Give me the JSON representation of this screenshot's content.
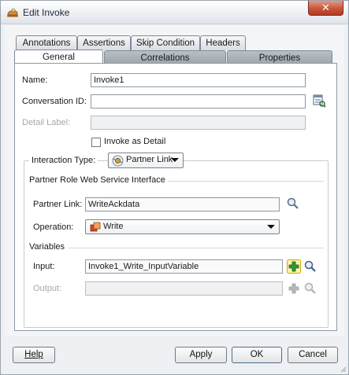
{
  "window": {
    "title": "Edit Invoke",
    "close_glyph": "✕"
  },
  "tabs": {
    "row1": [
      "Annotations",
      "Assertions",
      "Skip Condition",
      "Headers"
    ],
    "row2": [
      "General",
      "Correlations",
      "Properties"
    ],
    "active": "General"
  },
  "form": {
    "name_label": "Name:",
    "name_value": "Invoke1",
    "conversation_label": "Conversation ID:",
    "conversation_value": "",
    "detail_label": "Detail Label:",
    "detail_value": "",
    "invoke_as_detail": {
      "label": "Invoke as Detail",
      "checked": false
    },
    "interaction_type_label": "Interaction Type:",
    "interaction_type_value": "Partner Link",
    "partner_section_title": "Partner Role Web Service Interface",
    "partner_link_label": "Partner Link:",
    "partner_link_value": "WriteAckdata",
    "operation_label": "Operation:",
    "operation_value": "Write",
    "variables_title": "Variables",
    "input_label": "Input:",
    "input_value": "Invoke1_Write_InputVariable",
    "output_label": "Output:",
    "output_value": ""
  },
  "buttons": {
    "help": "Help",
    "apply": "Apply",
    "ok": "OK",
    "cancel": "Cancel"
  },
  "colors": {
    "accent": "#2e9a2e",
    "close": "#c9553a",
    "operation_icon": "#d2452b"
  },
  "icons": [
    "bpel-invoke-icon",
    "close-icon",
    "variable-lookup-icon",
    "partner-link-icon",
    "search-icon",
    "write-operation-icon",
    "add-icon",
    "chevron-down-icon"
  ]
}
